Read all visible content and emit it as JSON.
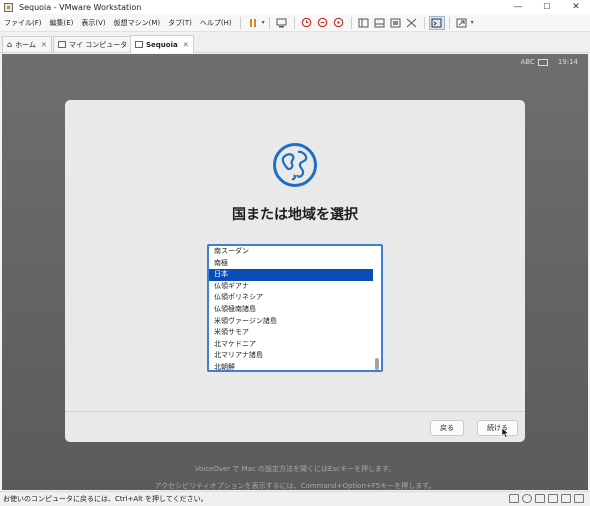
{
  "window": {
    "title": "Sequoia - VMware Workstation"
  },
  "menu": [
    "ファイル(F)",
    "編集(E)",
    "表示(V)",
    "仮想マシン(M)",
    "タブ(T)",
    "ヘルプ(H)"
  ],
  "toolbar_icons": [
    "pause-icon",
    "send-ctrl-alt-del-icon",
    "snapshot-icon",
    "revert-snapshot-icon",
    "manage-snapshots-icon",
    "library-view-icon",
    "thumbnail-view-icon",
    "fit-window-icon",
    "unity-icon",
    "console-view-icon",
    "fullscreen-icon"
  ],
  "tabs": [
    {
      "label": "ホーム",
      "active": false
    },
    {
      "label": "マイ コンピュータ",
      "active": false
    },
    {
      "label": "Sequoia",
      "active": true
    }
  ],
  "vm": {
    "input_mode": "ABC",
    "clock": "19:14",
    "dialog_title": "国または地域を選択",
    "countries": [
      "南スーダン",
      "南極",
      "日本",
      "仏領ギアナ",
      "仏領ポリネシア",
      "仏領極南諸島",
      "米領ヴァージン諸島",
      "米領サモア",
      "北マケドニア",
      "北マリアナ諸島",
      "北朝鮮"
    ],
    "selected_country": "日本",
    "back_label": "戻る",
    "continue_label": "続ける",
    "hint_voiceover": "VoiceOver で Mac の設定方法を聞くにはEscキーを押します。",
    "hint_accessibility": "アクセシビリティオプションを表示するには、Command+Option+F5キーを押します。"
  },
  "statusbar": {
    "text": "お使いのコンピュータに戻るには、Ctrl+Alt を押してください。"
  },
  "colors": {
    "accent": "#0a4db8",
    "list_border": "#3f7fd6",
    "pause": "#e67e22",
    "globe": "#1e6fc1"
  }
}
